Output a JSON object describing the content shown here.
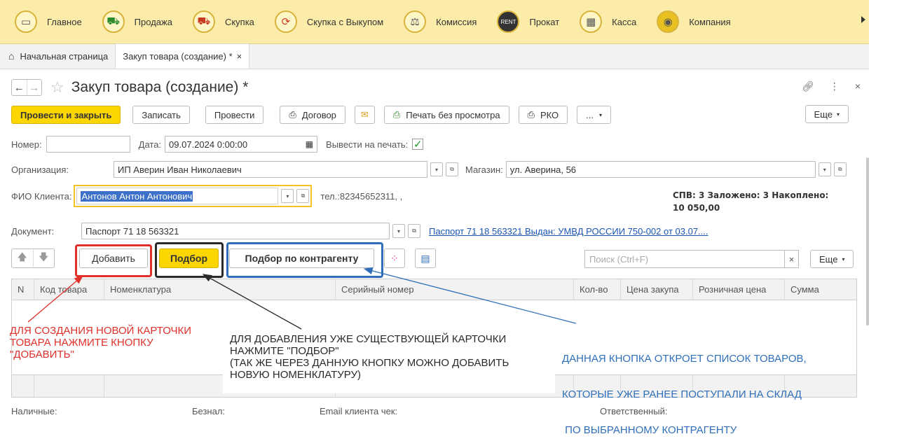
{
  "topnav": [
    {
      "icon": "monitor-icon",
      "label": "Главное"
    },
    {
      "icon": "cart-icon",
      "label": "Продажа"
    },
    {
      "icon": "basket-icon",
      "label": "Скупка"
    },
    {
      "icon": "cycle-icon",
      "label": "Скупка с Выкупом"
    },
    {
      "icon": "scales-icon",
      "label": "Комиссия"
    },
    {
      "icon": "rent-icon",
      "label": "Прокат"
    },
    {
      "icon": "cash-register-icon",
      "label": "Касса"
    },
    {
      "icon": "company-icon",
      "label": "Компания"
    }
  ],
  "tabs": {
    "home": "Начальная страница",
    "active": "Закуп товара (создание) *",
    "close": "×"
  },
  "form": {
    "title": "Закуп товара (создание) *",
    "buttons": {
      "post_close": "Провести и закрыть",
      "save": "Записать",
      "post": "Провести",
      "contract": "Договор",
      "print_no_preview": "Печать без просмотра",
      "rko": "РКО",
      "ellipsis": "...",
      "more": "Еще"
    },
    "number_label": "Номер:",
    "number_value": "",
    "date_label": "Дата:",
    "date_value": "09.07.2024  0:00:00",
    "print_label": "Вывести на печать:",
    "org_label": "Организация:",
    "org_value": "ИП Аверин Иван Николаевич",
    "shop_label": "Магазин:",
    "shop_value": "ул. Аверина, 56",
    "client_label": "ФИО Клиента:",
    "client_value": "Антонов Антон Антонович",
    "phone": "тел.:82345652311, ,",
    "stats_line1": "СПВ: 3 Заложено: 3 Накоплено:",
    "stats_line2": "10 050,00",
    "doc_label": "Документ:",
    "doc_value": "Паспорт 71 18 563321",
    "doc_link": "Паспорт 71 18 563321 Выдан: УМВД РОССИИ 750-002 от 03.07...."
  },
  "table_toolbar": {
    "add": "Добавить",
    "pick": "Подбор",
    "pick_by_counterparty": "Подбор по контрагенту",
    "search_placeholder": "Поиск (Ctrl+F)",
    "clear": "×",
    "more": "Еще"
  },
  "table": {
    "columns": [
      "N",
      "Код товара",
      "Номенклатура",
      "Серийный номер",
      "Кол-во",
      "Цена закупа",
      "Розничная цена",
      "Сумма"
    ]
  },
  "footer": {
    "cash": "Наличные:",
    "noncash": "Безнал:",
    "email": "Email клиента чек:",
    "responsible": "Ответственный:"
  },
  "annotations": {
    "red": [
      "ДЛЯ СОЗДАНИЯ НОВОЙ КАРТОЧКИ",
      "ТОВАРА НАЖМИТЕ КНОПКУ",
      "\"ДОБАВИТЬ\""
    ],
    "black": [
      "ДЛЯ ДОБАВЛЕНИЯ УЖЕ СУЩЕСТВУЮЩЕЙ КАРТОЧКИ",
      "НАЖМИТЕ \"ПОДБОР\"",
      "(ТАК ЖЕ ЧЕРЕЗ ДАННУЮ КНОПКУ МОЖНО ДОБАВИТЬ",
      "НОВУЮ НОМЕНКЛАТУРУ)"
    ],
    "blue": [
      "ДАННАЯ КНОПКА ОТКРОЕТ СПИСОК ТОВАРОВ,",
      "КОТОРЫЕ УЖЕ РАНЕЕ ПОСТУПАЛИ НА СКЛАД",
      " ПО ВЫБРАННОМУ КОНТРАГЕНТУ"
    ],
    "colors": {
      "red": "#e0302a",
      "black": "#2a2a2a",
      "blue": "#2f6fba"
    }
  }
}
